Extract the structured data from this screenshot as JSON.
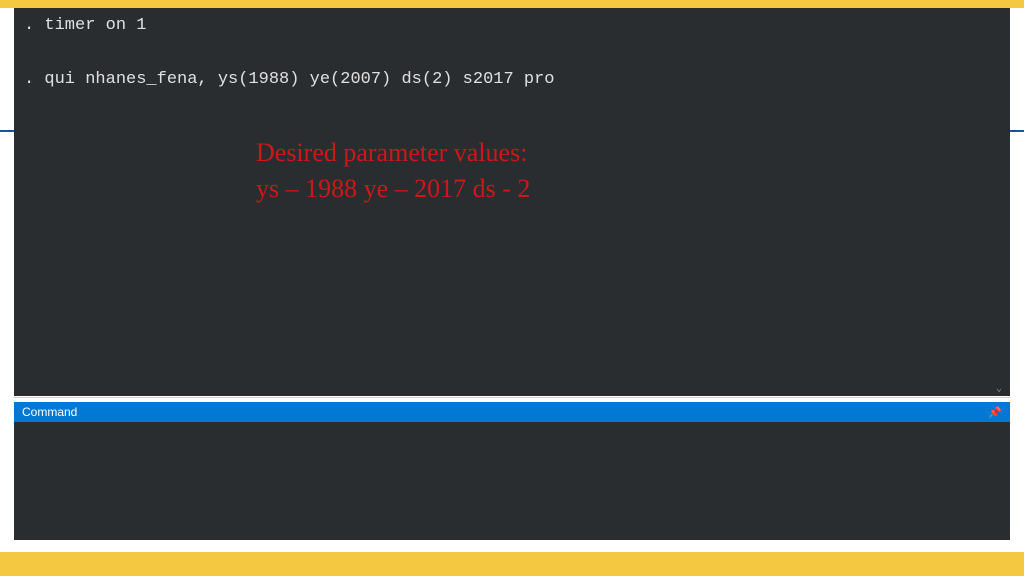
{
  "colors": {
    "accent_yellow": "#f5c842",
    "blue_header": "#0078d4",
    "terminal_bg": "#2a2d30",
    "annotation_red": "#cc1818",
    "blue_rule": "#1a5599"
  },
  "results": {
    "line1": ". timer on 1",
    "line2": ". qui nhanes_fena, ys(1988) ye(2007) ds(2) s2017 pro"
  },
  "annotation": {
    "line1": "Desired parameter values:",
    "line2": "ys – 1988 ye – 2017 ds - 2"
  },
  "command_panel": {
    "title": "Command",
    "input_value": ""
  }
}
